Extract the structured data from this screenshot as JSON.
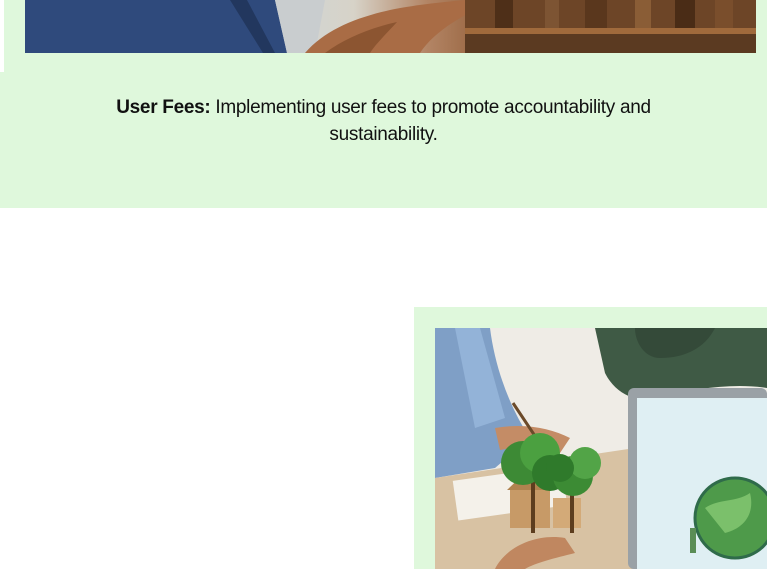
{
  "feature_card": {
    "caption_title": "User Fees:",
    "caption_text": " Implementing user fees to promote accountability and sustainability.",
    "image_subject": "person-photo"
  },
  "second_card": {
    "image_subject": "green-sustainability-photo"
  },
  "colors": {
    "card_background": "#dff8dc",
    "page_background": "#ffffff",
    "text": "#111111"
  }
}
